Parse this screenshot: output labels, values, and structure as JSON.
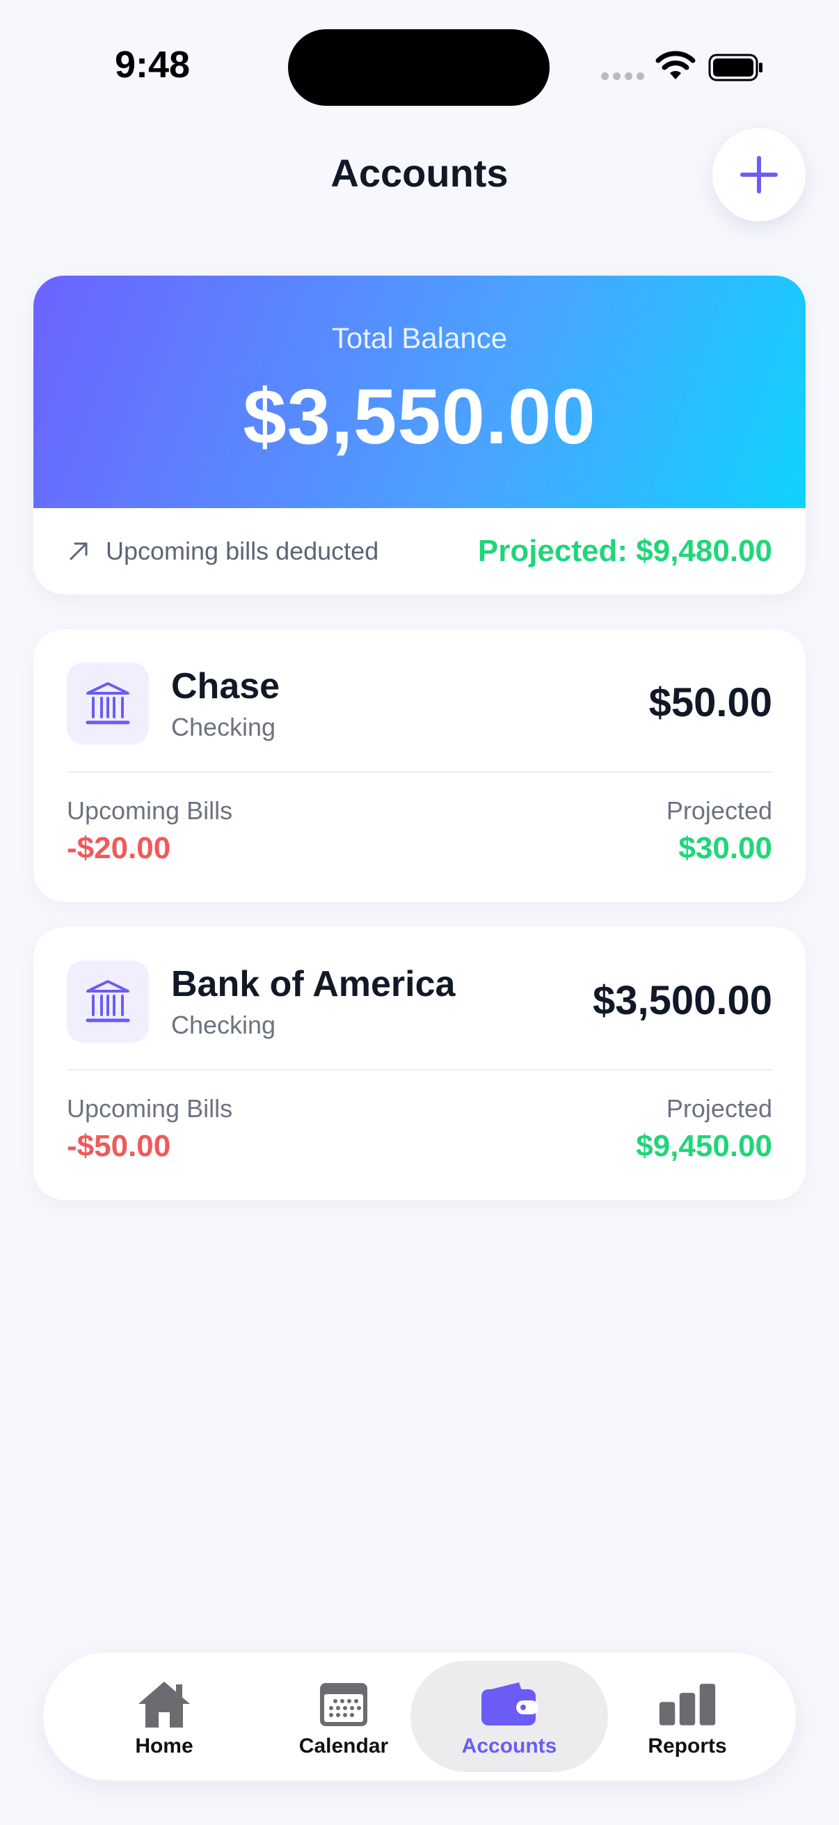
{
  "status_bar": {
    "time": "9:48"
  },
  "header": {
    "title": "Accounts"
  },
  "total": {
    "label": "Total Balance",
    "amount": "$3,550.00",
    "note": "Upcoming bills deducted",
    "projected": "Projected: $9,480.00"
  },
  "accounts": [
    {
      "name": "Chase",
      "type": "Checking",
      "balance": "$50.00",
      "upcoming_label": "Upcoming Bills",
      "upcoming_value": "-$20.00",
      "projected_label": "Projected",
      "projected_value": "$30.00"
    },
    {
      "name": "Bank of America",
      "type": "Checking",
      "balance": "$3,500.00",
      "upcoming_label": "Upcoming Bills",
      "upcoming_value": "-$50.00",
      "projected_label": "Projected",
      "projected_value": "$9,450.00"
    }
  ],
  "tabs": [
    {
      "label": "Home",
      "icon": "house-icon"
    },
    {
      "label": "Calendar",
      "icon": "calendar-icon"
    },
    {
      "label": "Accounts",
      "icon": "wallet-icon",
      "active": true
    },
    {
      "label": "Reports",
      "icon": "bar-chart-icon"
    }
  ],
  "colors": {
    "accent": "#6a5cf5",
    "positive": "#1fd679",
    "negative": "#f0595b",
    "gradient_start": "#6c63ff",
    "gradient_end": "#0fd2ff"
  }
}
